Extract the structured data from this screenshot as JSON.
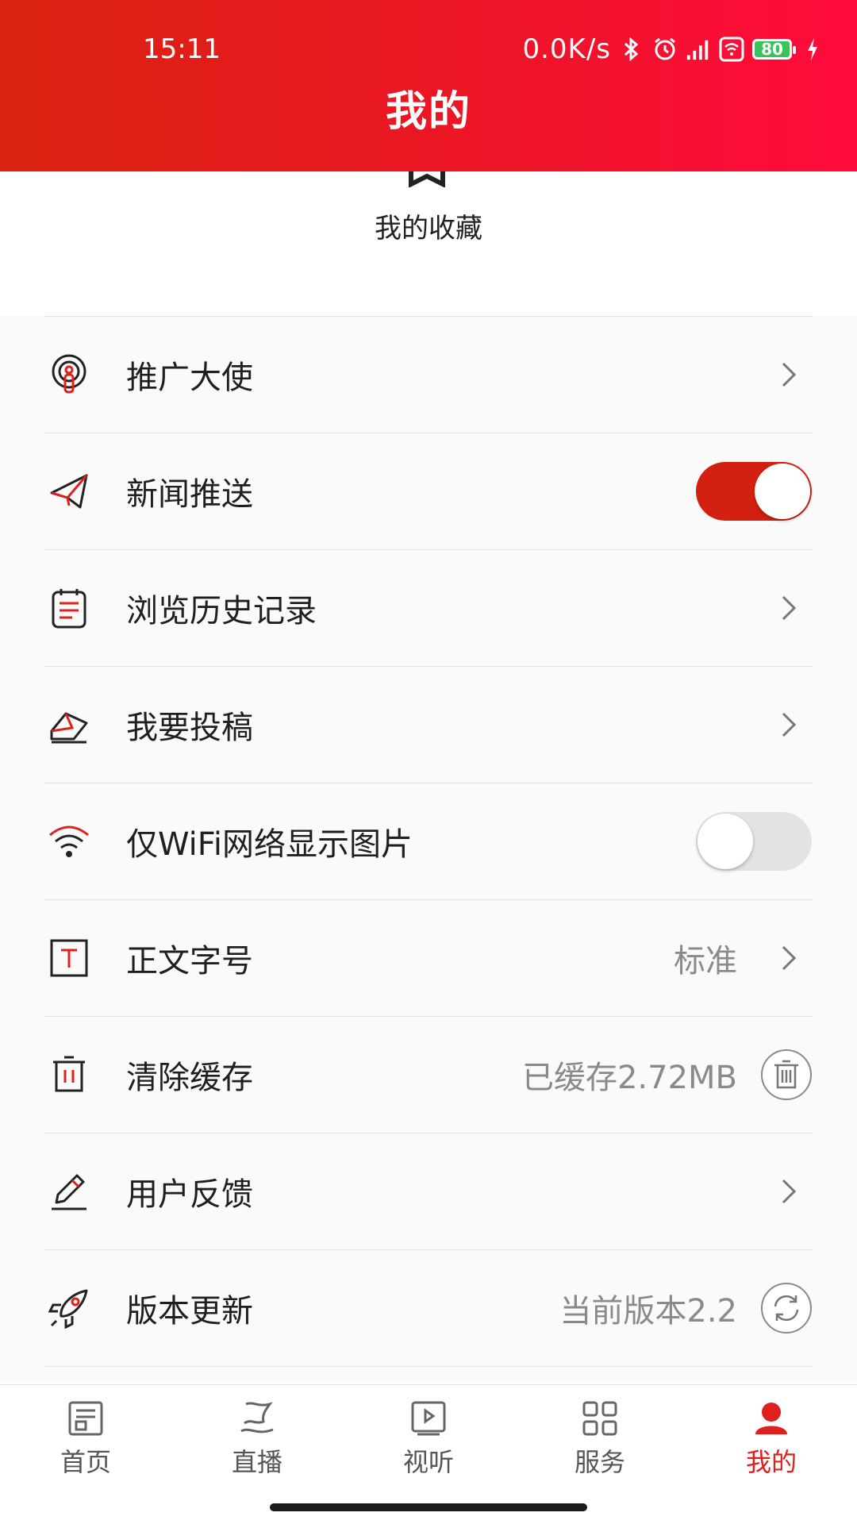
{
  "status": {
    "time": "15:11",
    "network": "0.0K/s",
    "battery": "80"
  },
  "page": {
    "title": "我的"
  },
  "favorites": {
    "label": "我的收藏"
  },
  "settings": {
    "items": [
      {
        "label": "推广大使",
        "icon": "ambassador-icon"
      },
      {
        "label": "新闻推送",
        "icon": "paper-plane-icon",
        "toggle": true
      },
      {
        "label": "浏览历史记录",
        "icon": "clipboard-icon"
      },
      {
        "label": "我要投稿",
        "icon": "envelope-icon"
      },
      {
        "label": "仅WiFi网络显示图片",
        "icon": "wifi-icon",
        "toggle": false
      },
      {
        "label": "正文字号",
        "icon": "text-size-icon",
        "value": "标准"
      },
      {
        "label": "清除缓存",
        "icon": "trash-icon",
        "value": "已缓存2.72MB"
      },
      {
        "label": "用户反馈",
        "icon": "pencil-icon"
      },
      {
        "label": "版本更新",
        "icon": "rocket-icon",
        "value": "当前版本2.2"
      }
    ]
  },
  "bottom_nav": {
    "items": [
      {
        "label": "首页",
        "icon": "newspaper-icon"
      },
      {
        "label": "直播",
        "icon": "flag-icon"
      },
      {
        "label": "视听",
        "icon": "video-icon"
      },
      {
        "label": "服务",
        "icon": "grid-icon"
      },
      {
        "label": "我的",
        "icon": "user-icon",
        "active": true
      }
    ]
  },
  "colors": {
    "accent": "#e0201d",
    "header_start": "#d9230f",
    "header_end": "#ff0a3c"
  }
}
